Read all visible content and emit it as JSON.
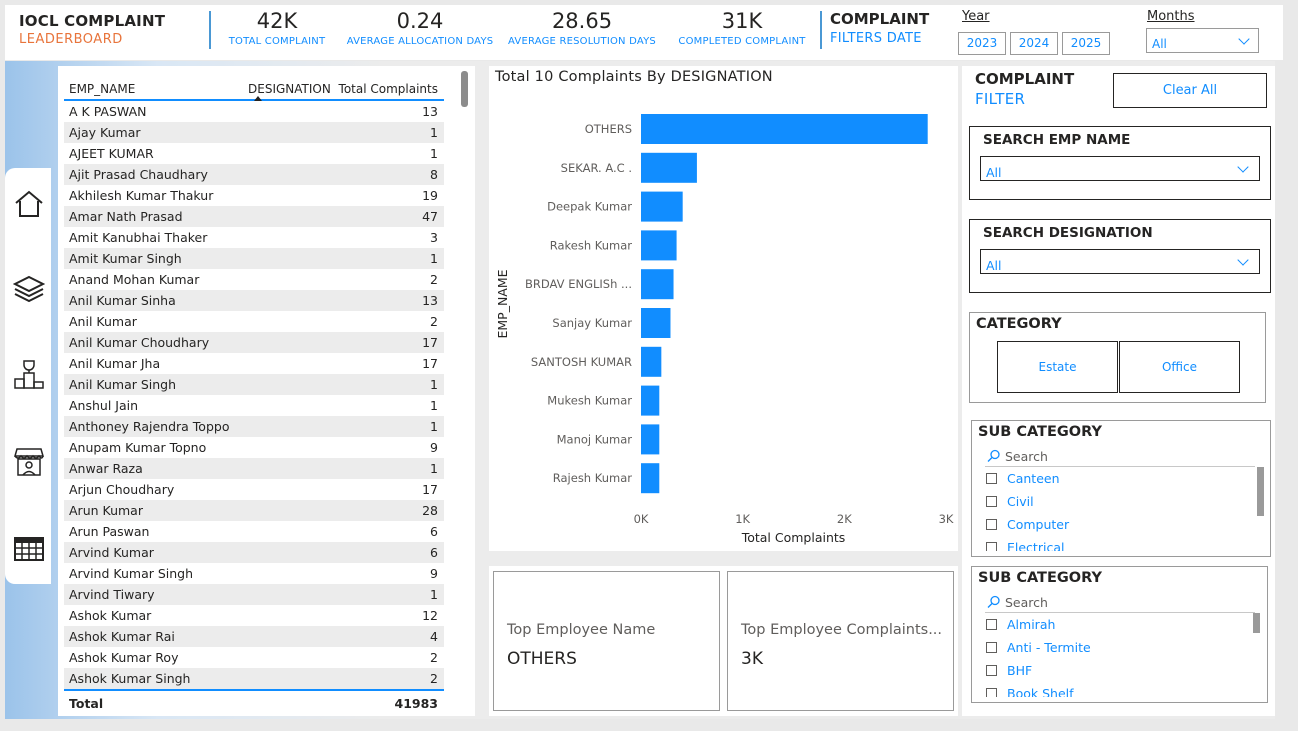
{
  "header": {
    "title_line1": "IOCL COMPLAINT",
    "title_line2": "LEADERBOARD",
    "kpis": [
      {
        "value": "42K",
        "label": "TOTAL COMPLAINT"
      },
      {
        "value": "0.24",
        "label": "AVERAGE ALLOCATION DAYS"
      },
      {
        "value": "28.65",
        "label": "AVERAGE RESOLUTION DAYS"
      },
      {
        "value": "31K",
        "label": "COMPLETED COMPLAINT"
      }
    ],
    "filters_line1": "COMPLAINT",
    "filters_line2": "FILTERS DATE",
    "year_label": "Year",
    "years": [
      "2023",
      "2024",
      "2025"
    ],
    "months_label": "Months",
    "months_value": "All"
  },
  "nav": [
    "home-icon",
    "layers-icon",
    "podium-icon",
    "store-icon",
    "table-icon"
  ],
  "table": {
    "columns": [
      "EMP_NAME",
      "DESIGNATION",
      "Total Complaints"
    ],
    "rows": [
      [
        "A K PASWAN",
        "13"
      ],
      [
        "Ajay Kumar",
        "1"
      ],
      [
        "AJEET KUMAR",
        "1"
      ],
      [
        "Ajit Prasad Chaudhary",
        "8"
      ],
      [
        "Akhilesh Kumar Thakur",
        "19"
      ],
      [
        "Amar Nath Prasad",
        "47"
      ],
      [
        "Amit Kanubhai Thaker",
        "3"
      ],
      [
        "Amit Kumar Singh",
        "1"
      ],
      [
        "Anand Mohan Kumar",
        "2"
      ],
      [
        "Anil Kumar Sinha",
        "13"
      ],
      [
        "Anil Kumar",
        "2"
      ],
      [
        "Anil Kumar Choudhary",
        "17"
      ],
      [
        "Anil Kumar Jha",
        "17"
      ],
      [
        "Anil Kumar Singh",
        "1"
      ],
      [
        "Anshul Jain",
        "1"
      ],
      [
        "Anthoney Rajendra Toppo",
        "1"
      ],
      [
        "Anupam Kumar Topno",
        "9"
      ],
      [
        "Anwar Raza",
        "1"
      ],
      [
        "Arjun Choudhary",
        "17"
      ],
      [
        "Arun Kumar",
        "28"
      ],
      [
        "Arun Paswan",
        "6"
      ],
      [
        "Arvind Kumar",
        "6"
      ],
      [
        "Arvind Kumar Singh",
        "9"
      ],
      [
        "Arvind Tiwary",
        "1"
      ],
      [
        "Ashok Kumar",
        "12"
      ],
      [
        "Ashok Kumar Rai",
        "4"
      ],
      [
        "Ashok Kumar Roy",
        "2"
      ],
      [
        "Ashok Kumar Singh",
        "2"
      ]
    ],
    "total_label": "Total",
    "total_value": "41983"
  },
  "chart": {
    "title": "Total 10 Complaints By DESIGNATION",
    "bar_color": "#118dff"
  },
  "chart_data": {
    "type": "bar",
    "orientation": "horizontal",
    "categories": [
      "OTHERS",
      "SEKAR. A.C .",
      "Deepak Kumar",
      "Rakesh Kumar",
      "BRDAV ENGLISh ...",
      "Sanjay Kumar",
      "SANTOSH KUMAR",
      "Mukesh Kumar",
      "Manoj Kumar",
      "Rajesh Kumar"
    ],
    "values": [
      2820,
      550,
      410,
      350,
      320,
      290,
      200,
      180,
      180,
      180
    ],
    "xlabel": "Total Complaints",
    "ylabel": "EMP_NAME",
    "xlim": [
      0,
      3000
    ],
    "xticks": [
      "0K",
      "1K",
      "2K",
      "3K"
    ],
    "grid": false
  },
  "cards": [
    {
      "label": "Top Employee Name",
      "value": "OTHERS"
    },
    {
      "label": "Top Employee Complaints...",
      "value": "3K"
    }
  ],
  "filters": {
    "title_line1": "COMPLAINT",
    "title_line2": "FILTER",
    "clear_all": "Clear All",
    "search_emp_title": "SEARCH EMP NAME",
    "search_emp_value": "All",
    "search_desig_title": "SEARCH DESIGNATION",
    "search_desig_value": "All",
    "category_title": "CATEGORY",
    "categories": [
      "Estate",
      "Office"
    ],
    "sub1_title": "SUB CATEGORY",
    "sub1_search": "Search",
    "sub1_items": [
      "Canteen",
      "Civil",
      "Computer",
      "Electrical"
    ],
    "sub2_title": "SUB CATEGORY",
    "sub2_search": "Search",
    "sub2_items": [
      "Almirah",
      "Anti - Termite",
      "BHF",
      "Book Shelf"
    ]
  }
}
